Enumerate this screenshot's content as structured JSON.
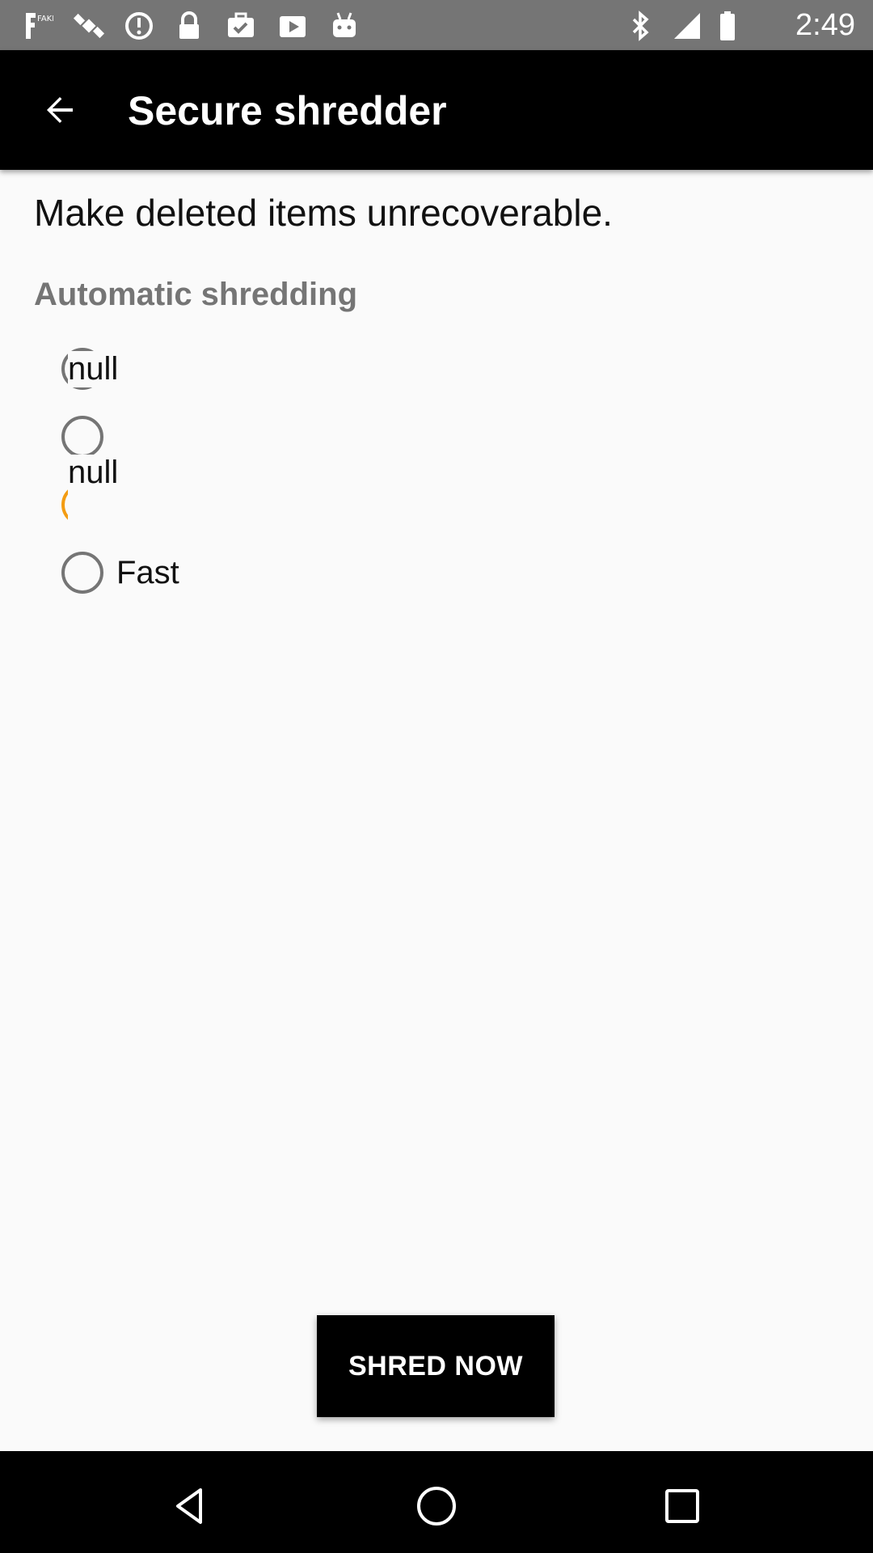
{
  "status_bar": {
    "time": "2:49",
    "icons": [
      "fake-gps-icon",
      "satellite-icon",
      "sync-icon",
      "lock-icon",
      "briefcase-check-icon",
      "play-store-icon",
      "android-icon",
      "bluetooth-icon",
      "signal-icon",
      "battery-icon"
    ],
    "background": "#757575"
  },
  "app_bar": {
    "back_icon": "arrow-back-icon",
    "title": "Secure shredder",
    "background": "#000000"
  },
  "content": {
    "description": "Make deleted items unrecoverable.",
    "section_header": "Automatic shredding",
    "options": [
      {
        "label": "null",
        "selected": false
      },
      {
        "label": "null",
        "selected": true
      },
      {
        "label": "Fast",
        "selected": false
      }
    ],
    "accent_color": "#f39c12"
  },
  "actions": {
    "shred_now_label": "SHRED NOW"
  },
  "nav_bar": {
    "back_icon": "nav-back-icon",
    "home_icon": "nav-home-icon",
    "recents_icon": "nav-recents-icon"
  }
}
